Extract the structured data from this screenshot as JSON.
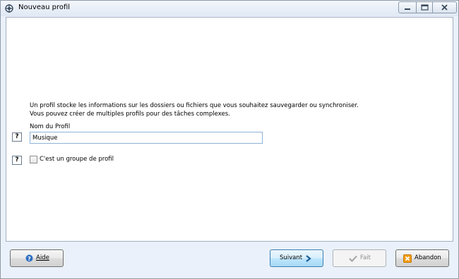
{
  "window": {
    "title": "Nouveau profil"
  },
  "description": {
    "line1": "Un profil stocke les informations sur les dossiers ou fichiers que vous souhaitez sauvegarder ou synchroniser.",
    "line2": "Vous pouvez créer de multiples profils pour des tâches complexes."
  },
  "profile_name": {
    "label": "Nom du Profil",
    "value": "Musique",
    "help": "?"
  },
  "group_option": {
    "label": "C'est un groupe de profil",
    "checked": false,
    "help": "?"
  },
  "buttons": {
    "help": "Aide",
    "next": "Suivant",
    "done": "Fait",
    "abort": "Abandon"
  },
  "colors": {
    "accent": "#3c7fb1",
    "disabled_text": "#8d8d8d",
    "abort_icon": "#f39c12"
  }
}
